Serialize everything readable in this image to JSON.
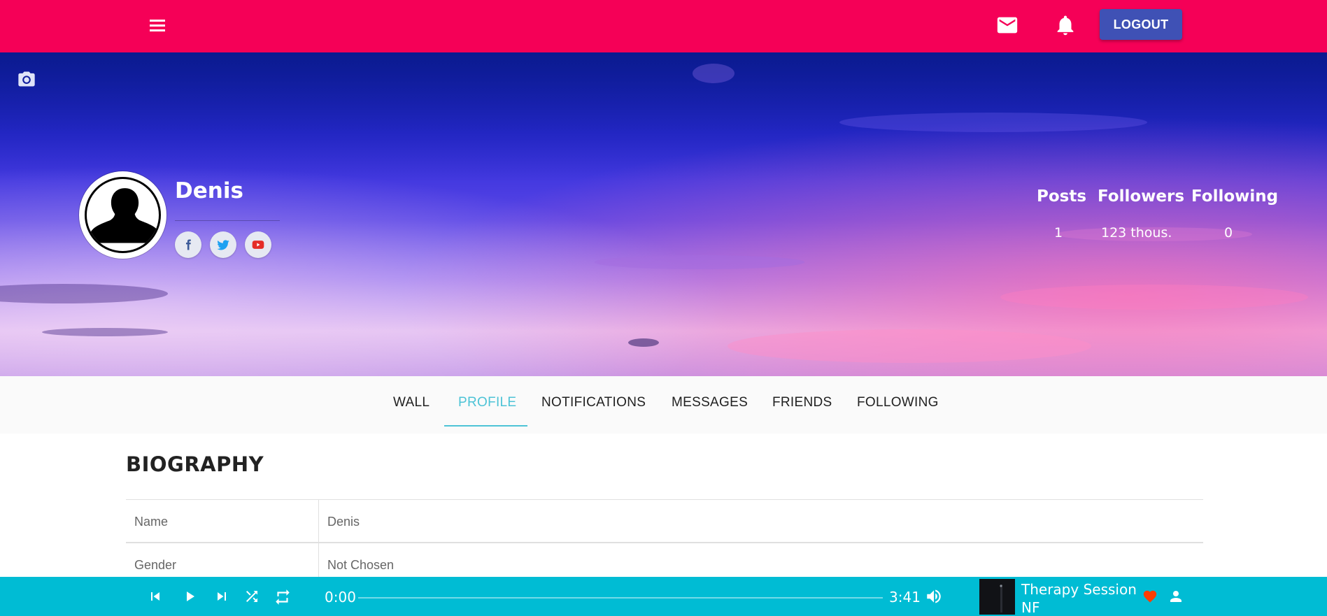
{
  "colors": {
    "topbar": "#f50057",
    "logout_button": "#3f51b5",
    "tab_active": "#4dc3d6",
    "player_bar": "#00bcd4",
    "heart": "#ff3d00"
  },
  "header": {
    "menu_icon": "hamburger-menu-icon",
    "mail_icon": "mail-icon",
    "notification_icon": "bell-icon",
    "logout_label": "LOGOUT"
  },
  "hero": {
    "camera_icon": "camera-icon",
    "profile_name": "Denis",
    "social_icons": [
      "facebook-icon",
      "twitter-icon",
      "youtube-icon"
    ],
    "stats": [
      {
        "label": "Posts",
        "value": "1"
      },
      {
        "label": "Followers",
        "value": "123 thous."
      },
      {
        "label": "Following",
        "value": "0"
      }
    ]
  },
  "tabs": [
    {
      "label": "WALL",
      "active": false
    },
    {
      "label": "PROFILE",
      "active": true
    },
    {
      "label": "NOTIFICATIONS",
      "active": false
    },
    {
      "label": "MESSAGES",
      "active": false
    },
    {
      "label": "FRIENDS",
      "active": false
    },
    {
      "label": "FOLLOWING",
      "active": false
    }
  ],
  "biography": {
    "title": "BIOGRAPHY",
    "rows": [
      {
        "key": "Name",
        "value": "Denis"
      },
      {
        "key": "Gender",
        "value": "Not Chosen"
      }
    ]
  },
  "player": {
    "current_time": "0:00",
    "duration": "3:41",
    "progress": 0,
    "track_title": "Therapy Session",
    "track_artist": "NF",
    "controls": [
      "skip-previous-icon",
      "play-icon",
      "skip-next-icon",
      "shuffle-icon",
      "repeat-icon",
      "volume-icon"
    ],
    "favorite_icon": "heart-icon",
    "artist_icon": "person-icon"
  }
}
